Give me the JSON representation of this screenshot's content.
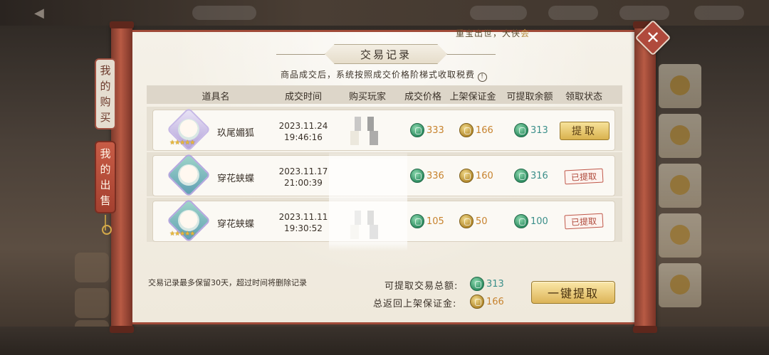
{
  "window": {
    "title": "交易记录",
    "marquee_main": "重宝出世，大侠",
    "marquee_tail": "会",
    "close_label": "✕"
  },
  "tabs": [
    {
      "label_chars": [
        "我",
        "的",
        "购",
        "买"
      ],
      "selected": false
    },
    {
      "label_chars": [
        "我",
        "的",
        "出",
        "售"
      ],
      "selected": true
    }
  ],
  "notice": "商品成交后，系统按照成交价格阶梯式收取税费",
  "info_icon": "!",
  "table": {
    "headers": [
      "道具名",
      "成交时间",
      "购买玩家",
      "成交价格",
      "上架保证金",
      "可提取余额",
      "领取状态"
    ],
    "rows": [
      {
        "item": "玖尾媚狐",
        "icon": "fox-portrait-icon",
        "stars": "★★★★★",
        "date": "2023.11.24",
        "time": "19:46:16",
        "price": "333",
        "deposit": "166",
        "balance": "313",
        "status": "提取",
        "status_type": "button"
      },
      {
        "item": "穿花蛱蝶",
        "icon": "butterfly-girl-icon",
        "stars": "★★★★★",
        "date": "2023.11.17",
        "time": "21:00:39",
        "price": "336",
        "deposit": "160",
        "balance": "316",
        "status": "已提取",
        "status_type": "stamp"
      },
      {
        "item": "穿花蛱蝶",
        "icon": "butterfly-girl-icon",
        "stars": "★★★★★",
        "date": "2023.11.11",
        "time": "19:30:52",
        "price": "105",
        "deposit": "50",
        "balance": "100",
        "status": "已提取",
        "status_type": "stamp"
      }
    ]
  },
  "footer": {
    "retention_note": "交易记录最多保留30天，超过时间将删除记录",
    "total_label": "可提取交易总额:",
    "total_value": "313",
    "deposit_label": "总返回上架保证金:",
    "deposit_value": "166",
    "claim_all": "一键提取"
  },
  "colors": {
    "accent_red": "#a04a38",
    "gold": "#d9b24e",
    "jade": "#2f8e62",
    "amount_orange": "#c7832e",
    "amount_sea": "#3b8f8a"
  }
}
